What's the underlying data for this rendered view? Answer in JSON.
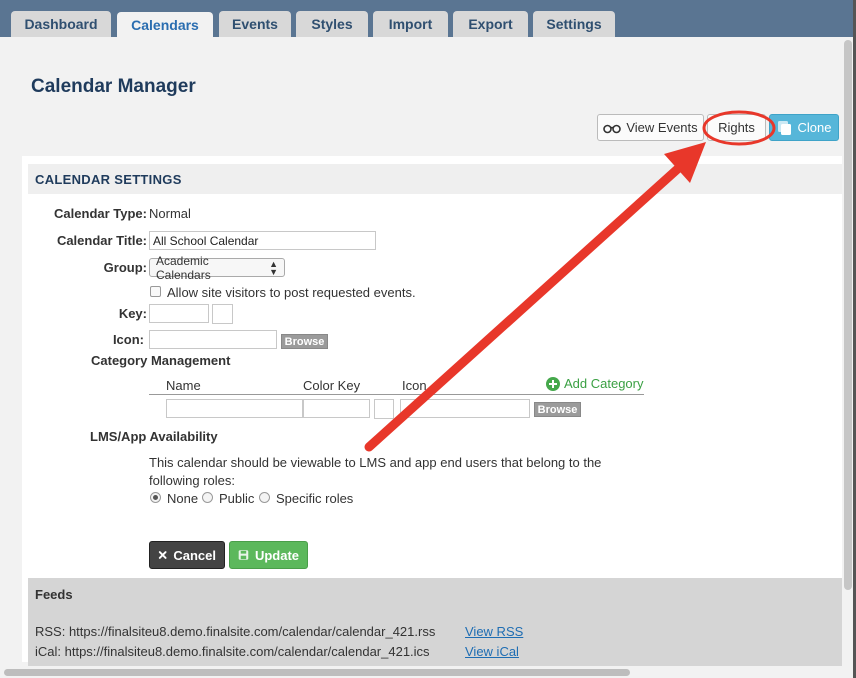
{
  "tabs": [
    {
      "label": "Dashboard"
    },
    {
      "label": "Calendars"
    },
    {
      "label": "Events"
    },
    {
      "label": "Styles"
    },
    {
      "label": "Import"
    },
    {
      "label": "Export"
    },
    {
      "label": "Settings"
    }
  ],
  "page_title": "Calendar Manager",
  "toolbar": {
    "view_events": "View Events",
    "rights": "Rights",
    "clone": "Clone"
  },
  "settings": {
    "heading": "CALENDAR SETTINGS",
    "type_label": "Calendar Type:",
    "type_value": "Normal",
    "title_label": "Calendar Title:",
    "title_value": "All School Calendar",
    "group_label": "Group:",
    "group_value": "Academic Calendars",
    "allow_label": "Allow site visitors to post requested events.",
    "key_label": "Key:",
    "icon_label": "Icon:",
    "browse": "Browse"
  },
  "category": {
    "heading": "Category Management",
    "col_name": "Name",
    "col_color": "Color Key",
    "col_icon": "Icon",
    "add": "Add Category",
    "browse": "Browse"
  },
  "lms": {
    "heading": "LMS/App Availability",
    "desc_line1": "This calendar should be viewable to LMS and app end users that belong to the",
    "desc_line2": "following roles:",
    "options": [
      "None",
      "Public",
      "Specific roles"
    ],
    "selected": "None"
  },
  "actions": {
    "cancel": "Cancel",
    "update": "Update"
  },
  "feeds": {
    "heading": "Feeds",
    "rss_text": "RSS: https://finalsiteu8.demo.finalsite.com/calendar/calendar_421.rss",
    "rss_link": "View RSS",
    "ical_text": "iCal: https://finalsiteu8.demo.finalsite.com/calendar/calendar_421.ics",
    "ical_link": "View iCal"
  },
  "colors": {
    "tabbar": "#5a7592",
    "annotation": "#e8372a",
    "clone": "#56b6d9",
    "update": "#5cb85c",
    "cancel": "#444444"
  }
}
